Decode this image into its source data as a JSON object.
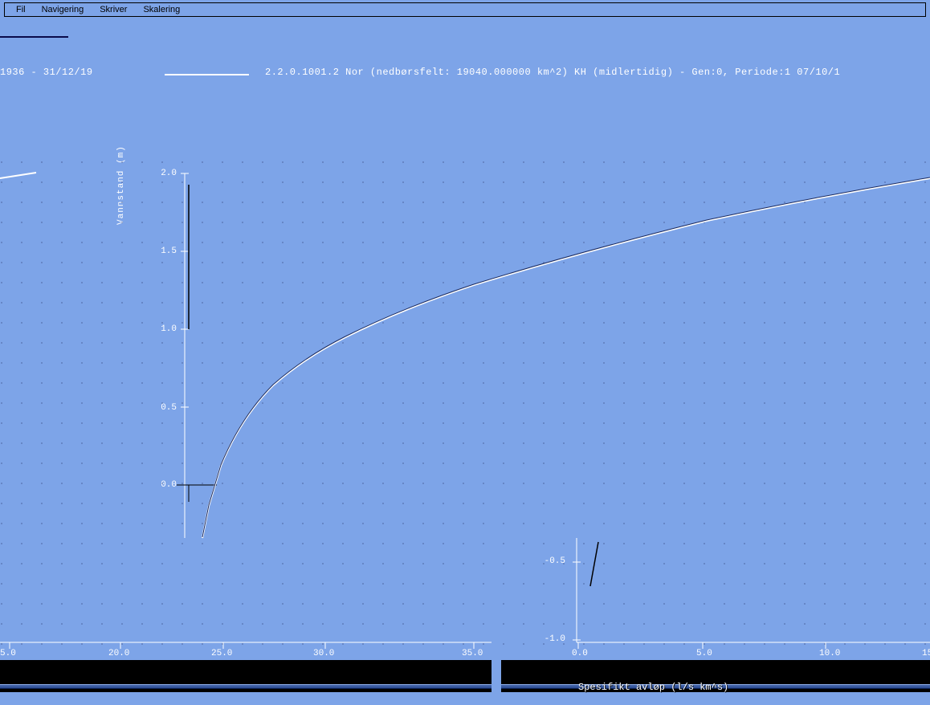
{
  "menu": {
    "items": [
      "Fil",
      "Navigering",
      "Skriver",
      "Skalering"
    ]
  },
  "legend": {
    "date_range": "1936 - 31/12/19",
    "series_info": "2.2.0.1001.2 Nor (nedbørsfelt: 19040.000000 km^2) KH (midlertidig) - Gen:0, Periode:1 07/10/1"
  },
  "left_axis": {
    "label": "Vannstand (m)",
    "ticks": [
      "2.0",
      "1.5",
      "1.0",
      "0.5",
      "0.0"
    ],
    "xticks": [
      "5.0",
      "20.0",
      "25.0",
      "30.0",
      "35.0"
    ]
  },
  "right_axis": {
    "ticks": [
      "-0.5",
      "-1.0"
    ],
    "xticks": [
      "0.0",
      "5.0",
      "10.0",
      "15"
    ],
    "xlabel": "Spesifikt avløp (l/s km^s)"
  },
  "chart_data": {
    "type": "line",
    "title": "",
    "panels": [
      {
        "name": "left-panel",
        "ylabel": "Vannstand (m)",
        "xlabel": "",
        "ylim": [
          -0.4,
          2.0
        ],
        "xlim": [
          15.0,
          35.0
        ],
        "series": [
          {
            "name": "white-curve",
            "color": "#ffffff",
            "x": [
              22.8,
              23.5,
              24.5,
              26.0,
              28.0,
              30.0,
              33.0,
              36.0,
              42.0,
              50.0,
              65.0
            ],
            "y": [
              -0.35,
              -0.05,
              0.25,
              0.55,
              0.78,
              0.92,
              1.1,
              1.25,
              1.5,
              1.7,
              1.95
            ]
          },
          {
            "name": "fragment-top-left",
            "color": "#ffffff",
            "x": [
              0.0,
              2.5
            ],
            "y": [
              2.0,
              2.05
            ]
          }
        ],
        "markers": [
          {
            "type": "vline",
            "x": 23.5,
            "y0": 0.0,
            "y1": 1.8,
            "color": "#000"
          },
          {
            "type": "hline",
            "y": 0.0,
            "x0": 22.5,
            "x1": 24.0,
            "color": "#000"
          }
        ]
      },
      {
        "name": "right-panel",
        "ylabel": "",
        "xlabel": "Spesifikt avløp (l/s km^s)",
        "ylim": [
          -1.0,
          -0.4
        ],
        "xlim": [
          0.0,
          15.0
        ],
        "series": [
          {
            "name": "small-fragment",
            "color": "#000",
            "x": [
              0.7,
              1.1
            ],
            "y": [
              -0.72,
              -0.45
            ]
          }
        ]
      }
    ]
  }
}
